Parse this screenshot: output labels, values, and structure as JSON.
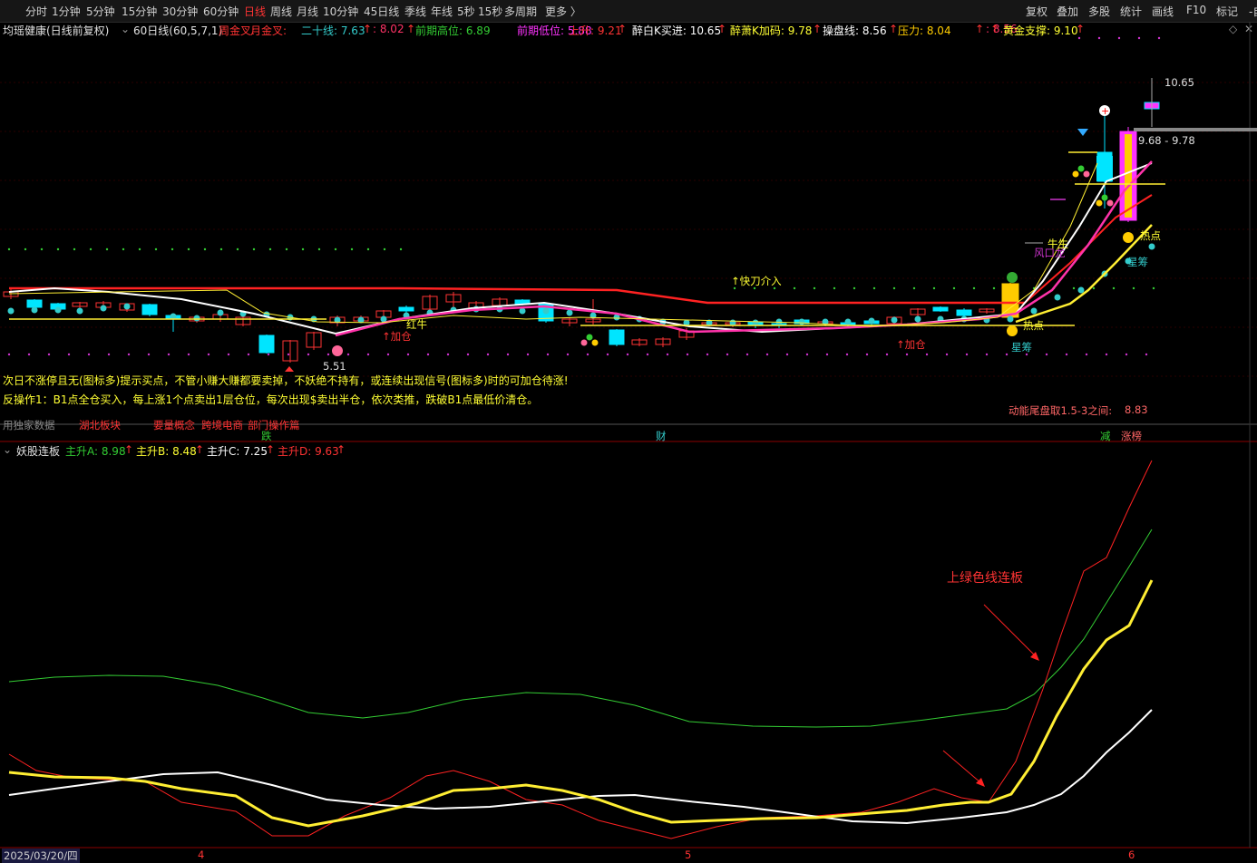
{
  "toolbar": {
    "periods": [
      "分时",
      "1分钟",
      "5分钟",
      "15分钟",
      "30分钟",
      "60分钟",
      "日线",
      "周线",
      "月线",
      "10分钟",
      "45日线",
      "季线",
      "年线",
      "5秒",
      "15秒",
      "多周期",
      "更多 〉"
    ],
    "active_period": "日线",
    "right_buttons": [
      "复权",
      "叠加",
      "多股",
      "统计",
      "画线",
      "F10",
      "标记",
      "-自"
    ]
  },
  "main_info": {
    "title": "均瑶健康(日线前复权)",
    "indicator": "60日线(60,5,7,1)",
    "items": [
      {
        "text": "周金叉:",
        "color": "#ff3333"
      },
      {
        "text": "月金叉:",
        "color": "#ff3333"
      },
      {
        "text": "二十线: 7.63",
        "color": "#33cccc"
      },
      {
        "text": "↑",
        "color": "#ff3333"
      },
      {
        "text": ": 8.02",
        "color": "#ff3366"
      },
      {
        "text": "↑",
        "color": "#ff3333"
      },
      {
        "text": "前期高位: 6.89",
        "color": "#33cc33"
      },
      {
        "text": "前期低位: 5.88",
        "color": "#ff33ff"
      },
      {
        "text": "上升: 9.21",
        "color": "#ff3333"
      },
      {
        "text": "↑",
        "color": "#ff3333"
      },
      {
        "text": "醉白K买进: 10.65",
        "color": "#ffffff"
      },
      {
        "text": "↑",
        "color": "#ff3333"
      },
      {
        "text": "醉萧K加码: 9.78",
        "color": "#ffff33"
      },
      {
        "text": "↑",
        "color": "#ff3333"
      },
      {
        "text": "操盘线: 8.56",
        "color": "#ffffff"
      },
      {
        "text": "↑",
        "color": "#ff3333"
      },
      {
        "text": "压力: 8.04",
        "color": "#ffcc00"
      },
      {
        "text": "↑",
        "color": "#ff3333"
      },
      {
        "text": ": 8.56",
        "color": "#ff3366"
      },
      {
        "text": "↑",
        "color": "#ff3333"
      },
      {
        "text": "黄金支撑: 9.10",
        "color": "#ffff33"
      },
      {
        "text": "↑",
        "color": "#ff3333"
      }
    ]
  },
  "chart_labels": {
    "high_price": "10.65",
    "range": "9.68 - 9.78",
    "low_price": "5.51",
    "kuaidao": "↑快刀介入",
    "jiacang1": "↑加仓",
    "jiacang2": "↑加仓",
    "hongniu": "红牛",
    "redian1": "热点",
    "redian2": "热点",
    "xingchou1": "星筹",
    "xingchou2": "星筹",
    "fengkou": "风口龙",
    "niusheng": "牛生",
    "dongneng": "动能尾盘取1.5-3之间:",
    "dongneng_val": "8.83",
    "tip1": "次日不涨停且无(图标多)提示买点，不管小赚大赚都要卖掉，不妖绝不持有，或连续出现信号(图标多)时的可加仓待涨!",
    "tip2": "反操作1：B1点全仓买入，每上涨1个点卖出1层仓位，每次出现$卖出半仓，依次类推，跌破B1点最低价清仓。",
    "concepts": [
      "用独家数据",
      "湖北板块",
      "要量概念",
      "跨境电商",
      "部门操作篇"
    ],
    "mark_die": "跌",
    "mark_cai": "财",
    "mark_jian": "减",
    "mark_zhang": "涨榜"
  },
  "sub_info": {
    "title": "妖股连板",
    "items": [
      {
        "text": "主升A: 8.98",
        "color": "#33cc33"
      },
      {
        "text": "↑",
        "color": "#ff3333"
      },
      {
        "text": "主升B: 8.48",
        "color": "#ffff33"
      },
      {
        "text": "↑",
        "color": "#ff3333"
      },
      {
        "text": "主升C: 7.25",
        "color": "#ffffff"
      },
      {
        "text": "↑",
        "color": "#ff3333"
      },
      {
        "text": "主升D: 9.63",
        "color": "#ff3333"
      },
      {
        "text": "↑",
        "color": "#ff3333"
      }
    ],
    "annotation": "上绿色线连板"
  },
  "axis": {
    "date": "2025/03/20/四",
    "months": [
      "4",
      "5",
      "6"
    ]
  },
  "colors": {
    "up": "#ff3333",
    "down": "#00e5ff",
    "bg": "#000000"
  }
}
